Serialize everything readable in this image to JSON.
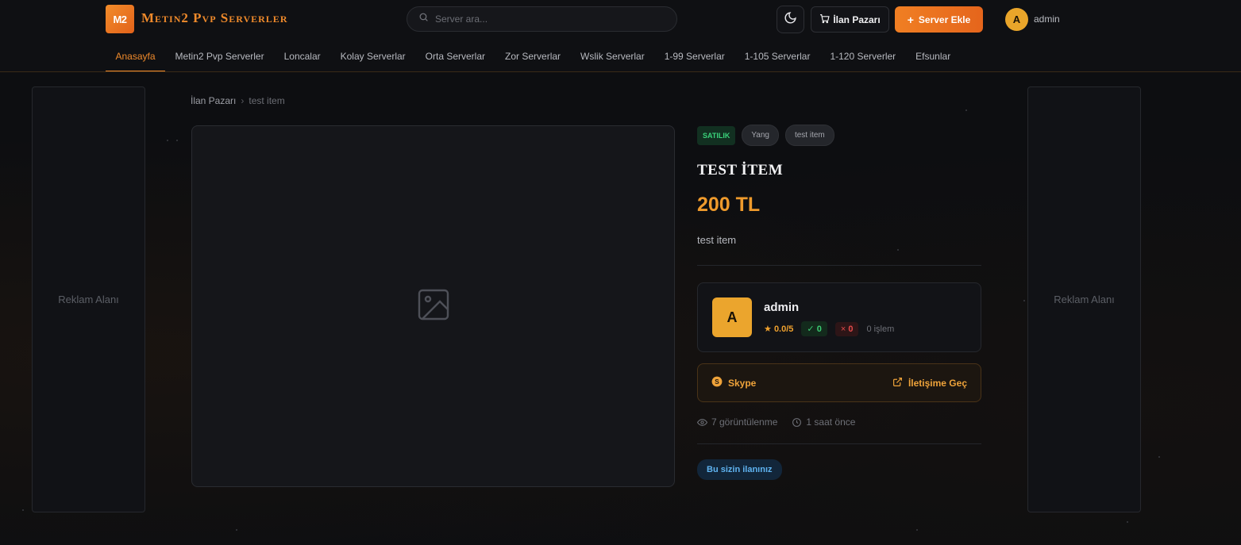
{
  "brand": {
    "logo_mark": "M2",
    "name": "Metin2 Pvp Serverler"
  },
  "search": {
    "placeholder": "Server ara..."
  },
  "header": {
    "market_label": "İlan Pazarı",
    "add_label": "Server Ekle",
    "user_initial": "A",
    "user_name": "admin"
  },
  "nav": [
    "Anasayfa",
    "Metin2 Pvp Serverler",
    "Loncalar",
    "Kolay Serverlar",
    "Orta Serverlar",
    "Zor Serverlar",
    "Wslik Serverlar",
    "1-99 Serverlar",
    "1-105 Serverlar",
    "1-120 Serverler",
    "Efsunlar"
  ],
  "ads": {
    "left": "Reklam Alanı",
    "right": "Reklam Alanı"
  },
  "breadcrumb": {
    "parent": "İlan Pazarı",
    "sep": "›",
    "current": "test item"
  },
  "item": {
    "status_tag": "SATILIK",
    "category_tag": "Yang",
    "name_tag": "test item",
    "title": "TEST İTEM",
    "price": "200 TL",
    "description": "test item"
  },
  "seller": {
    "initial": "A",
    "name": "admin",
    "rating": "0.0/5",
    "positive": "0",
    "negative": "0",
    "trades": "0 işlem"
  },
  "contact": {
    "method": "Skype",
    "action": "İletişime Geç"
  },
  "meta": {
    "views": "7 görüntülenme",
    "time": "1 saat önce"
  },
  "own_badge": "Bu sizin ilanınız",
  "colors": {
    "accent": "#ef8a2b",
    "background": "#0d0e11",
    "success": "#3ccc73",
    "danger": "#e24a4a",
    "info": "#5fb3f0"
  },
  "icons": [
    "search-icon",
    "moon-icon",
    "cart-icon",
    "plus-icon",
    "image-placeholder-icon",
    "star-icon",
    "check-icon",
    "x-icon",
    "skype-icon",
    "external-link-icon",
    "eye-icon",
    "clock-icon"
  ]
}
